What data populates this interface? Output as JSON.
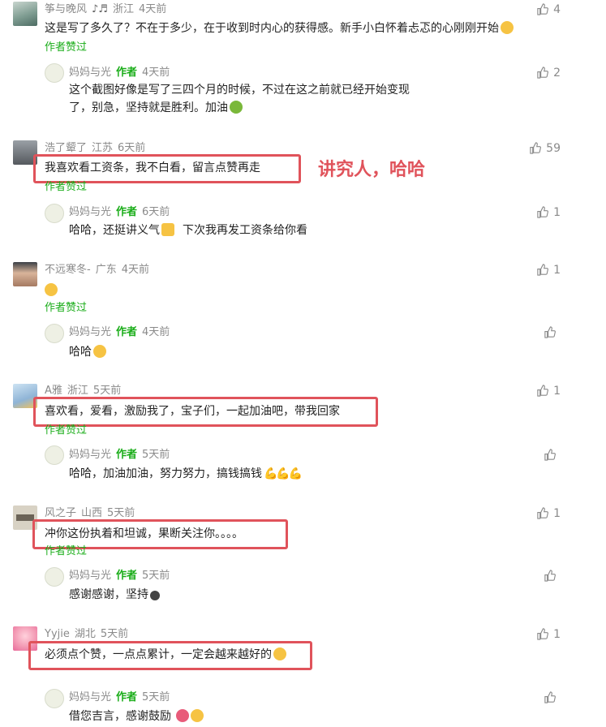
{
  "colors": {
    "author_green": "#1aad19",
    "meta_gray": "#8a8a8a",
    "highlight_red": "#e0535b"
  },
  "annotation": "讲究人，哈哈",
  "author_liked_label": "作者赞过",
  "author_tag": "作者",
  "comments": [
    {
      "user": "筝与晚风",
      "location": "浙江",
      "time": "4天前",
      "text": "这是写了多久了？不在于多少，在于收到时内心的获得感。新手小白怀着忐忑的心刚刚开始",
      "likes": "4",
      "reply": {
        "user": "妈妈与光",
        "time": "4天前",
        "text": "这个截图好像是写了三四个月的时候，不过在这之前就已经开始变现了，别急，坚持就是胜利。加油",
        "likes": "2"
      }
    },
    {
      "user": "浩了颦了",
      "location": "江苏",
      "time": "6天前",
      "text": "我喜欢看工资条，我不白看，留言点赞再走",
      "likes": "59",
      "reply": {
        "user": "妈妈与光",
        "time": "6天前",
        "text": "哈哈，还挺讲义气",
        "text2": "下次我再发工资条给你看",
        "likes": "1"
      }
    },
    {
      "user": "不远寒冬-",
      "location": "广东",
      "time": "4天前",
      "text": "",
      "likes": "1",
      "reply": {
        "user": "妈妈与光",
        "time": "4天前",
        "text": "哈哈",
        "likes": ""
      }
    },
    {
      "user": "A雅",
      "location": "浙江",
      "time": "5天前",
      "text": "喜欢看，爱看，激励我了，宝子们，一起加油吧，带我回家",
      "likes": "1",
      "reply": {
        "user": "妈妈与光",
        "time": "5天前",
        "text": "哈哈，加油加油，努力努力，搞钱搞钱",
        "likes": ""
      }
    },
    {
      "user": "风之子",
      "location": "山西",
      "time": "5天前",
      "text": "冲你这份执着和坦诚，果断关注你。。。。",
      "likes": "1",
      "reply": {
        "user": "妈妈与光",
        "time": "5天前",
        "text": "感谢感谢，坚持",
        "likes": ""
      }
    },
    {
      "user": "Yyjie",
      "location": "湖北",
      "time": "5天前",
      "text": "必须点个赞，一点点累计，一定会越来越好的",
      "likes": "1",
      "reply": {
        "user": "妈妈与光",
        "time": "5天前",
        "text": "借您吉言，感谢鼓励",
        "likes": ""
      }
    }
  ]
}
